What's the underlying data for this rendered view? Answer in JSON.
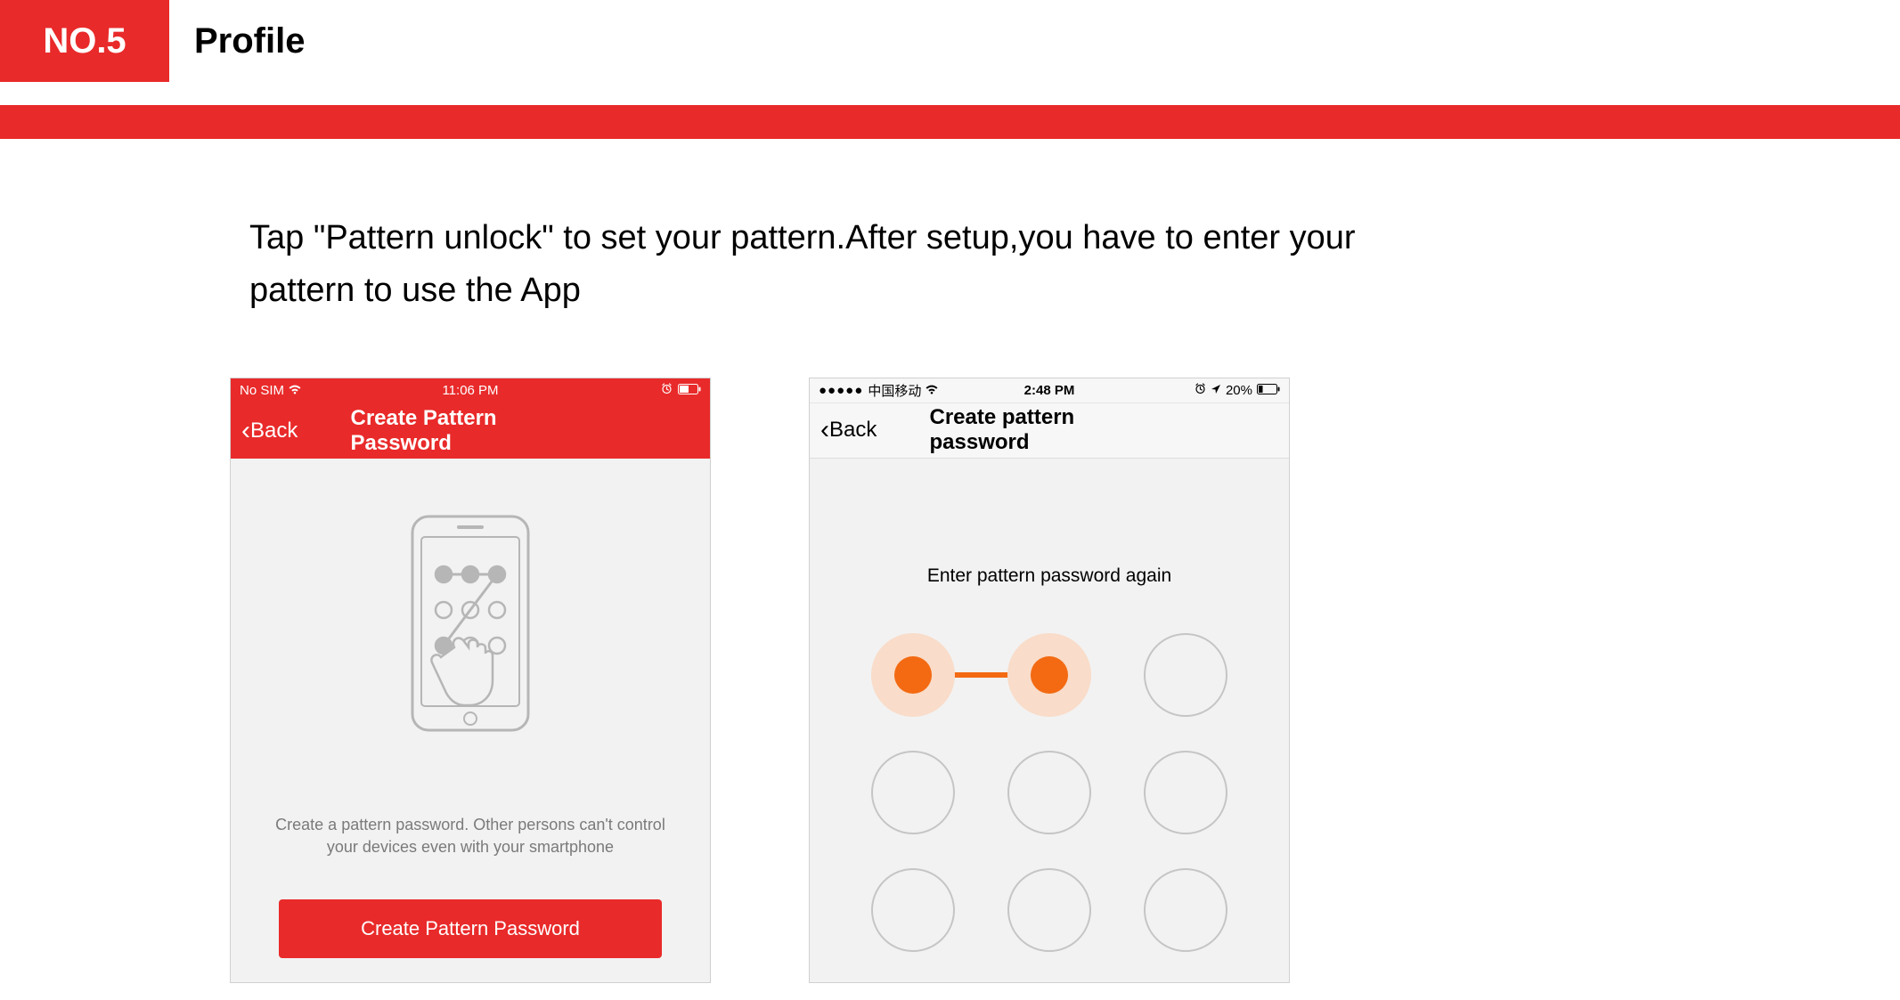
{
  "header": {
    "slide_number": "NO.5",
    "title": "Profile"
  },
  "body_text": "Tap \"Pattern unlock\" to set your pattern.After setup,you have to enter your pattern to use the App",
  "phoneA": {
    "status": {
      "carrier": "No SIM",
      "time": "11:06 PM"
    },
    "nav": {
      "back": "Back",
      "title": "Create Pattern Password"
    },
    "helper": "Create a pattern password. Other persons can't control your devices even with your smartphone",
    "cta": "Create Pattern Password"
  },
  "phoneB": {
    "status": {
      "carrier_dots": "●●●●●",
      "carrier": "中国移动",
      "time": "2:48 PM",
      "battery": "20%"
    },
    "nav": {
      "back": "Back",
      "title": "Create pattern password"
    },
    "prompt": "Enter pattern password again"
  }
}
